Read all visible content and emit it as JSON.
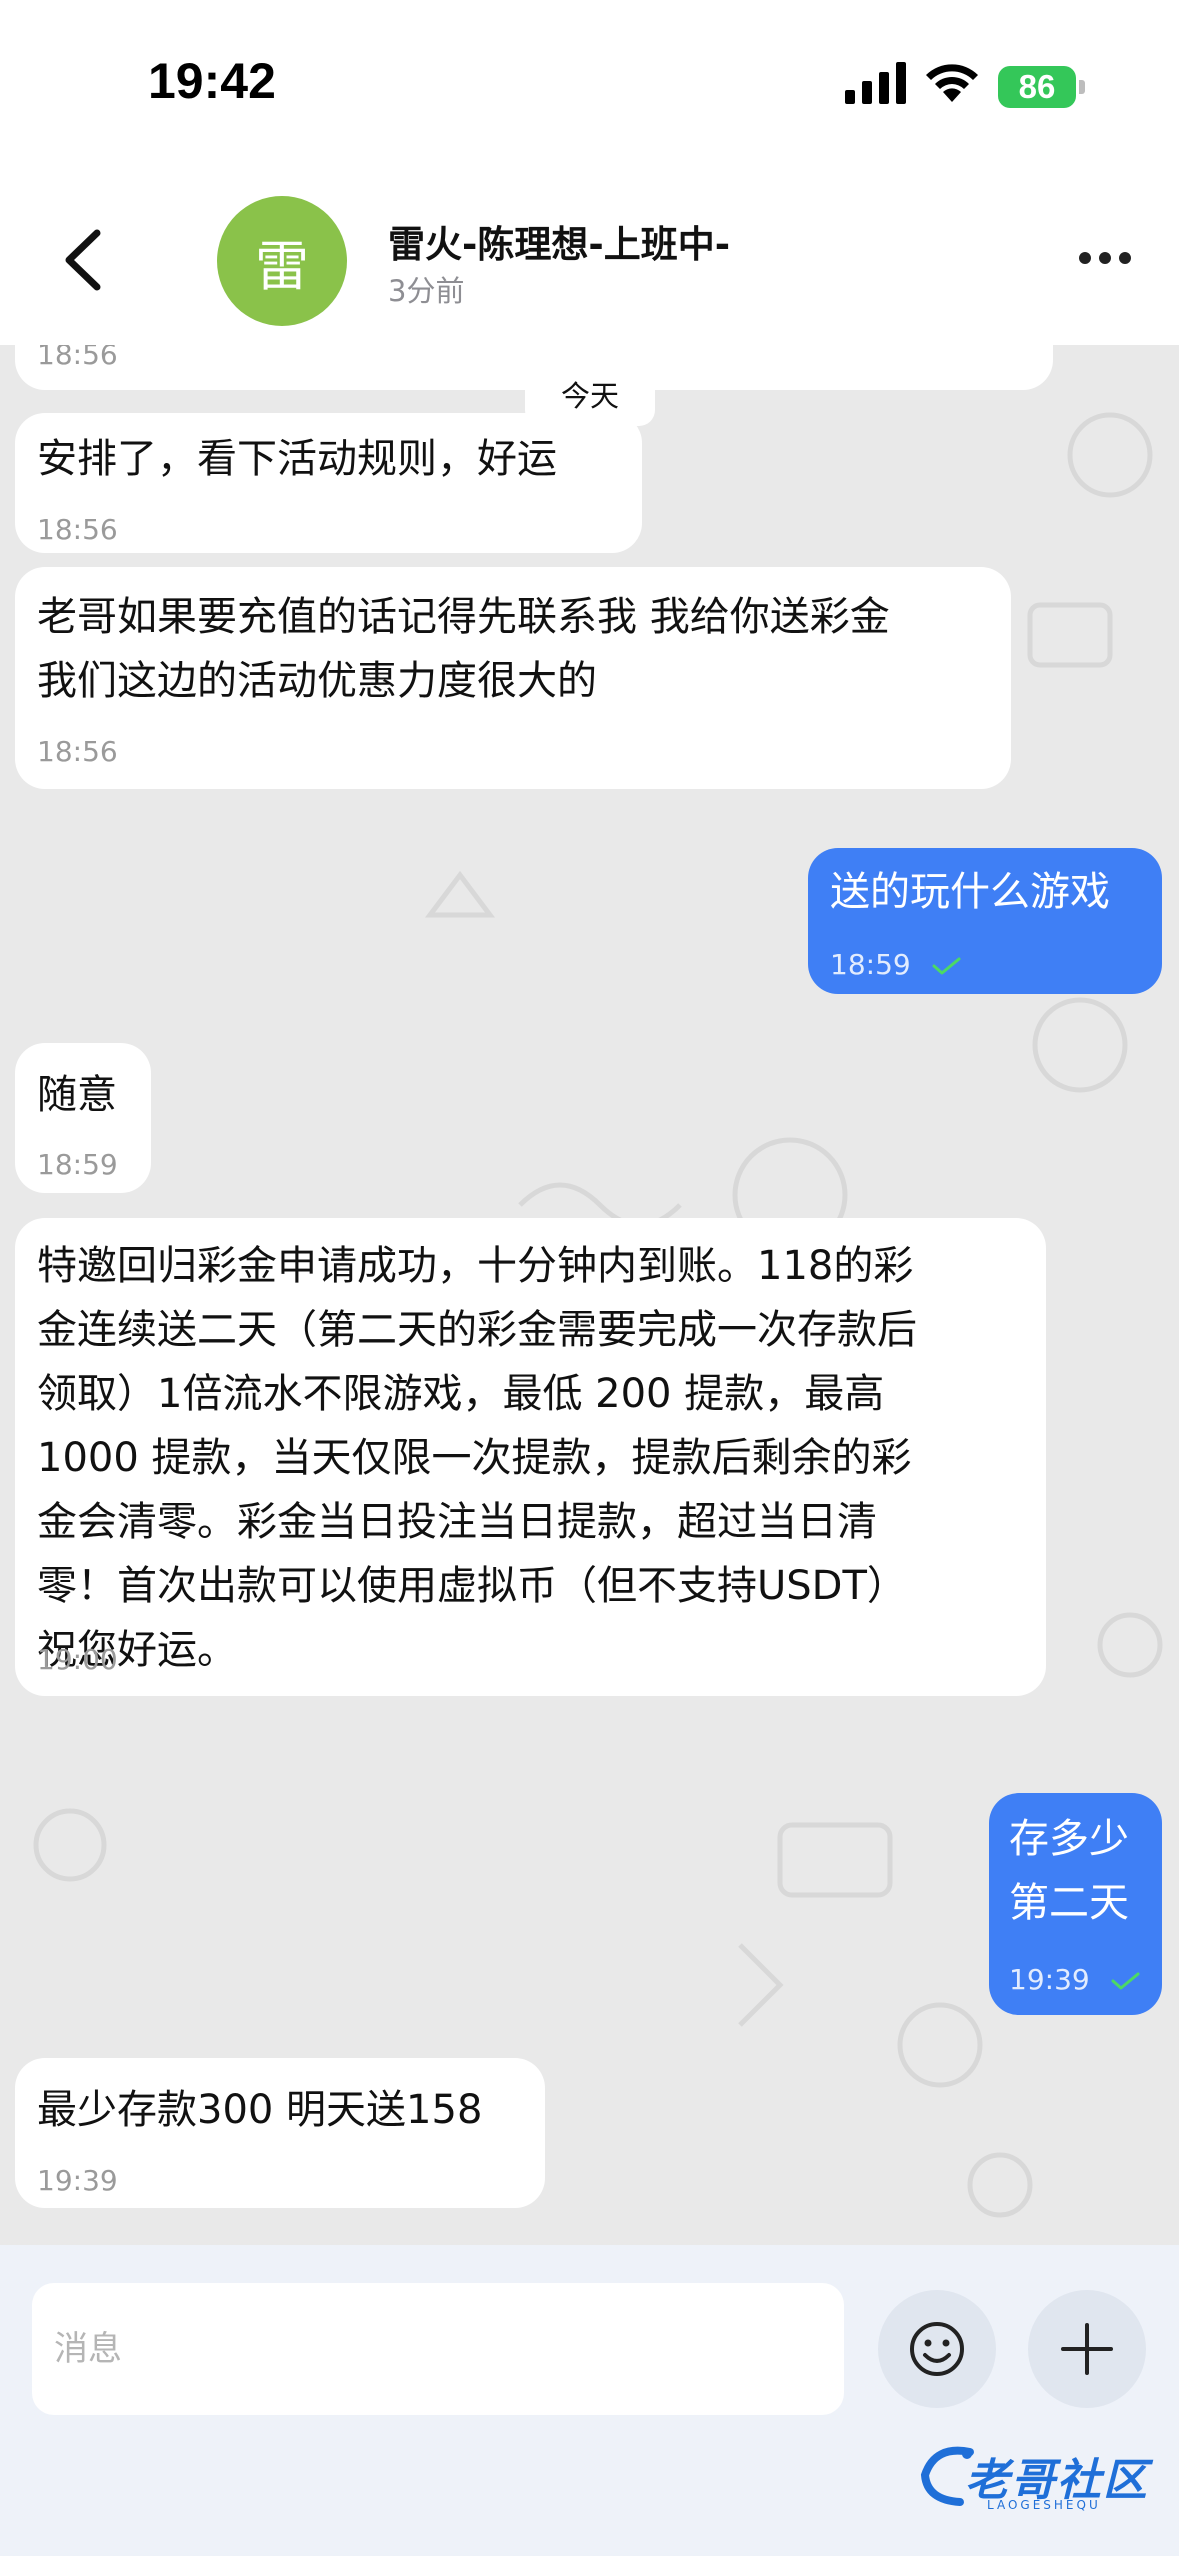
{
  "status_bar": {
    "time": "19:42",
    "battery_level": "86"
  },
  "header": {
    "avatar_char": "雷",
    "contact_name": "雷火-陈理想-上班中-",
    "last_seen": "3分前"
  },
  "chat": {
    "date_chip": "今天",
    "messages": [
      {
        "direction": "in",
        "text": "",
        "time": "18:56"
      },
      {
        "direction": "in",
        "text": "安排了，看下活动规则，好运",
        "time": "18:56"
      },
      {
        "direction": "in",
        "text": "老哥如果要充值的话记得先联系我 我给你送彩金\n我们这边的活动优惠力度很大的",
        "time": "18:56"
      },
      {
        "direction": "out",
        "text": "送的玩什么游戏",
        "time": "18:59",
        "status": "read"
      },
      {
        "direction": "in",
        "text": "随意",
        "time": "18:59"
      },
      {
        "direction": "in",
        "text": "特邀回归彩金申请成功，十分钟内到账。118的彩\n金连续送二天（第二天的彩金需要完成一次存款后\n领取）1倍流水不限游戏，最低 200 提款，最高\n1000 提款，当天仅限一次提款，提款后剩余的彩\n金会清零。彩金当日投注当日提款，超过当日清\n零！首次出款可以使用虚拟币（但不支持USDT）\n祝您好运。",
        "time": "19:00"
      },
      {
        "direction": "out",
        "text": "存多少\n第二天",
        "time": "19:39",
        "status": "read"
      },
      {
        "direction": "in",
        "text": "最少存款300 明天送158",
        "time": "19:39"
      }
    ]
  },
  "input_bar": {
    "placeholder": "消息"
  },
  "watermark": {
    "text": "老哥社区",
    "sub": "LAOGESHEQU"
  },
  "colors": {
    "outgoing_bubble": "#3f7ff5",
    "incoming_bubble": "#ffffff",
    "avatar": "#8ac24a",
    "battery": "#34c759",
    "read_check": "#4cd964"
  }
}
